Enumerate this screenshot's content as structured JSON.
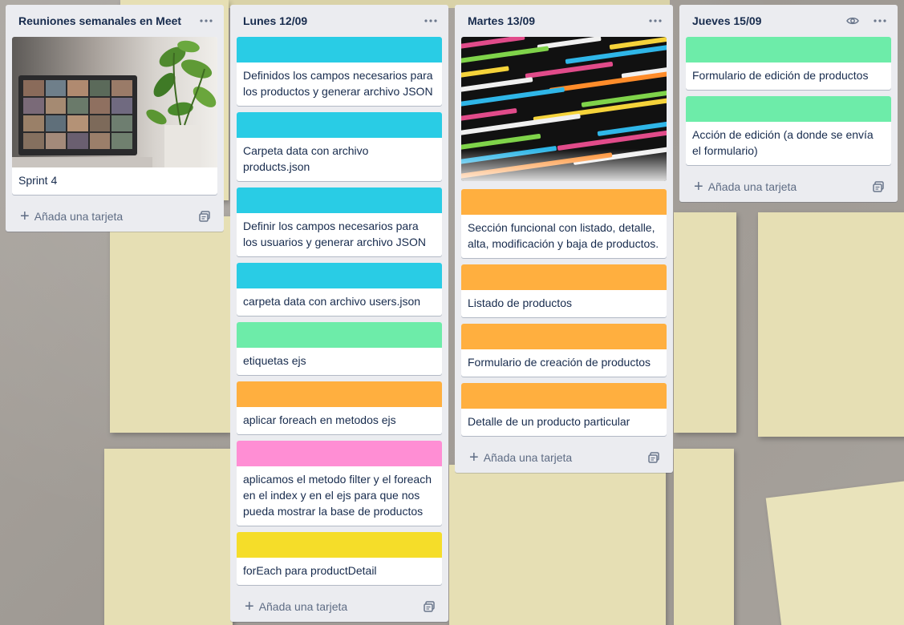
{
  "lists": [
    {
      "title": "Reuniones semanales en Meet",
      "menu_icon": "more-horizontal-icon",
      "cards": [
        {
          "cover": "meeting-photo",
          "text": "Sprint 4"
        }
      ],
      "add_label": "Añada una tarjeta",
      "template_icon": "card-template-icon"
    },
    {
      "title": "Lunes 12/09",
      "menu_icon": "more-horizontal-icon",
      "cards": [
        {
          "cover_color": "#29cce5",
          "text": "Definidos los campos necesarios para los productos y generar archivo JSON"
        },
        {
          "cover_color": "#29cce5",
          "text": "Carpeta data con archivo products.json"
        },
        {
          "cover_color": "#29cce5",
          "text": "Definir los campos necesarios para los usuarios y generar archivo JSON"
        },
        {
          "cover_color": "#29cce5",
          "text": "carpeta data con archivo users.json"
        },
        {
          "cover_color": "#6deca9",
          "text": "etiquetas ejs"
        },
        {
          "cover_color": "#ffaf3f",
          "text": "aplicar foreach en metodos ejs"
        },
        {
          "cover_color": "#ff8ed4",
          "text": "aplicamos el metodo filter y el foreach en el index y en el ejs para que nos pueda mostrar la base de productos"
        },
        {
          "cover_color": "#f5dd29",
          "text": "forEach para productDetail"
        }
      ],
      "add_label": "Añada una tarjeta"
    },
    {
      "title": "Martes 13/09",
      "menu_icon": "more-horizontal-icon",
      "cards": [
        {
          "cover": "code-photo",
          "text": ""
        },
        {
          "cover_color": "#ffaf3f",
          "text": "Sección funcional con listado, detalle, alta, modificación y baja de productos."
        },
        {
          "cover_color": "#ffaf3f",
          "text": "Listado de productos"
        },
        {
          "cover_color": "#ffaf3f",
          "text": "Formulario de creación de productos"
        },
        {
          "cover_color": "#ffaf3f",
          "text": "Detalle de un producto particular"
        }
      ],
      "add_label": "Añada una tarjeta"
    },
    {
      "title": "Jueves 15/09",
      "watch_icon": "eye-icon",
      "menu_icon": "more-horizontal-icon",
      "cards": [
        {
          "cover_color": "#6deca9",
          "text": "Formulario de edición de productos"
        },
        {
          "cover_color": "#6deca9",
          "text": "Acción de edición (a donde se envía el formulario)"
        }
      ],
      "add_label": "Añada una tarjeta"
    }
  ]
}
